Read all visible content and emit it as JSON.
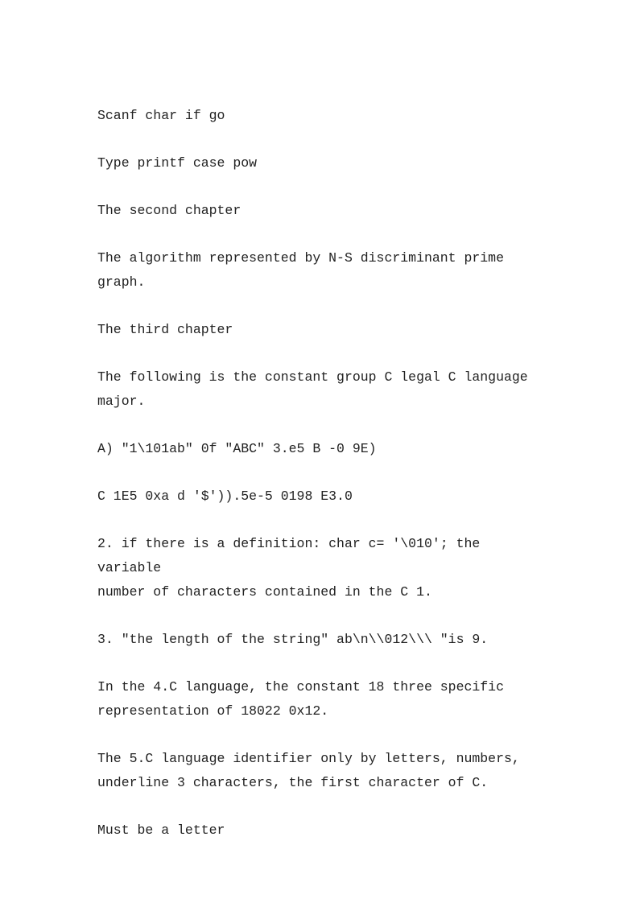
{
  "document": {
    "paragraphs": [
      "Scanf char if go",
      "Type printf case pow",
      "The second chapter",
      "The algorithm represented by N-S discriminant prime graph.",
      "The third chapter",
      "The following is the constant group C legal C language\nmajor.",
      "A) \"1\\101ab\" 0f \"ABC\" 3.e5 B -0 9E)",
      "C 1E5 0xa d '$')).5e-5 0198 E3.0",
      "2. if there is a definition: char c= '\\010'; the variable\nnumber of characters contained in the C 1.",
      "3. \"the length of the string\" ab\\n\\\\012\\\\\\ \"is 9.",
      "In the 4.C language, the constant 18 three specific\nrepresentation of 18022 0x12.",
      "The 5.C language identifier only by letters, numbers,\nunderline 3 characters, the first character of C.",
      "Must be a letter"
    ]
  }
}
